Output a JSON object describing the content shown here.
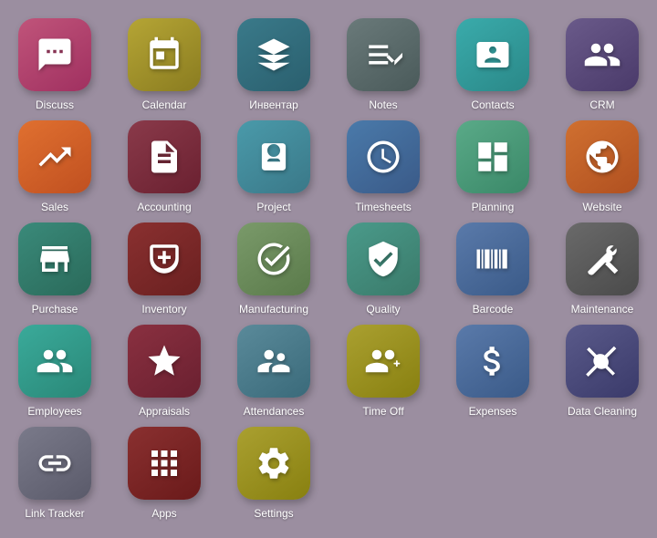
{
  "apps": [
    {
      "id": "discuss",
      "label": "Discuss",
      "color": "bg-pink",
      "icon": "discuss"
    },
    {
      "id": "calendar",
      "label": "Calendar",
      "color": "bg-olive",
      "icon": "calendar"
    },
    {
      "id": "inventar",
      "label": "Инвентар",
      "color": "bg-teal-dark",
      "icon": "diamond"
    },
    {
      "id": "notes",
      "label": "Notes",
      "color": "bg-gray-slate",
      "icon": "notes"
    },
    {
      "id": "contacts",
      "label": "Contacts",
      "color": "bg-teal-light",
      "icon": "contacts"
    },
    {
      "id": "crm",
      "label": "CRM",
      "color": "bg-purple-dark",
      "icon": "crm"
    },
    {
      "id": "sales",
      "label": "Sales",
      "color": "bg-orange",
      "icon": "sales"
    },
    {
      "id": "accounting",
      "label": "Accounting",
      "color": "bg-maroon",
      "icon": "accounting"
    },
    {
      "id": "project",
      "label": "Project",
      "color": "bg-blue-teal",
      "icon": "project"
    },
    {
      "id": "timesheets",
      "label": "Timesheets",
      "color": "bg-blue-slate",
      "icon": "timesheets"
    },
    {
      "id": "planning",
      "label": "Planning",
      "color": "bg-green-teal",
      "icon": "planning"
    },
    {
      "id": "website",
      "label": "Website",
      "color": "bg-orange-web",
      "icon": "website"
    },
    {
      "id": "purchase",
      "label": "Purchase",
      "color": "bg-teal-inv",
      "icon": "purchase"
    },
    {
      "id": "inventory",
      "label": "Inventory",
      "color": "bg-maroon-inv",
      "icon": "inventory"
    },
    {
      "id": "manufacturing",
      "label": "Manufacturing",
      "color": "bg-sage",
      "icon": "manufacturing"
    },
    {
      "id": "quality",
      "label": "Quality",
      "color": "bg-teal-qual",
      "icon": "quality"
    },
    {
      "id": "barcode",
      "label": "Barcode",
      "color": "bg-blue-bar",
      "icon": "barcode"
    },
    {
      "id": "maintenance",
      "label": "Maintenance",
      "color": "bg-gray-maint",
      "icon": "maintenance"
    },
    {
      "id": "employees",
      "label": "Employees",
      "color": "bg-teal-emp",
      "icon": "employees"
    },
    {
      "id": "appraisals",
      "label": "Appraisals",
      "color": "bg-maroon-app",
      "icon": "appraisals"
    },
    {
      "id": "attendances",
      "label": "Attendances",
      "color": "bg-teal-att",
      "icon": "attendances"
    },
    {
      "id": "timeoff",
      "label": "Time Off",
      "color": "bg-olive-time",
      "icon": "timeoff"
    },
    {
      "id": "expenses",
      "label": "Expenses",
      "color": "bg-blue-exp",
      "icon": "expenses"
    },
    {
      "id": "datacleaning",
      "label": "Data Cleaning",
      "color": "bg-purple-dc",
      "icon": "datacleaning"
    },
    {
      "id": "linktracker",
      "label": "Link Tracker",
      "color": "bg-gray-link",
      "icon": "linktracker"
    },
    {
      "id": "apps",
      "label": "Apps",
      "color": "bg-maroon-apps",
      "icon": "apps"
    },
    {
      "id": "settings",
      "label": "Settings",
      "color": "bg-olive-set",
      "icon": "settings"
    }
  ]
}
